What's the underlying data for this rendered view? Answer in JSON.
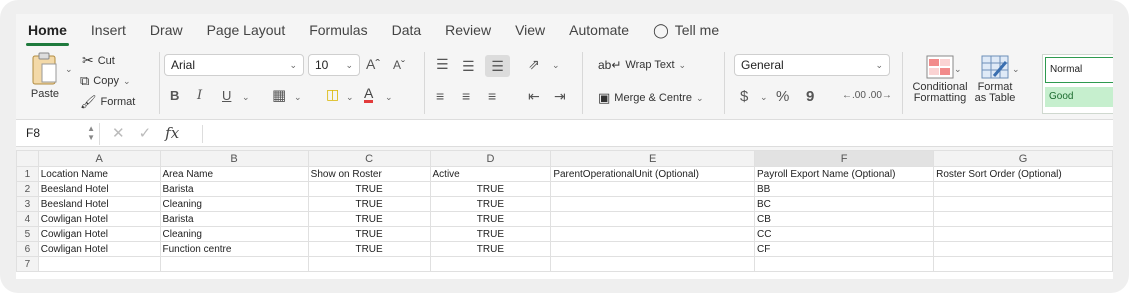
{
  "tabs": [
    "Home",
    "Insert",
    "Draw",
    "Page Layout",
    "Formulas",
    "Data",
    "Review",
    "View",
    "Automate"
  ],
  "tell_me": "Tell me",
  "clipboard": {
    "paste": "Paste",
    "cut": "Cut",
    "copy": "Copy",
    "format": "Format"
  },
  "font": {
    "name": "Arial",
    "size": "10",
    "bold": "B",
    "italic": "I",
    "underline": "U"
  },
  "alignment": {
    "wrap_text": "Wrap Text",
    "merge_center": "Merge & Centre"
  },
  "number": {
    "format": "General",
    "currency": "$",
    "percent": "%",
    "comma": "9"
  },
  "styles": {
    "conditional": "Conditional Formatting",
    "cond_line1": "Conditional",
    "cond_line2": "Formatting",
    "format_table_line1": "Format",
    "format_table_line2": "as Table",
    "normal": "Normal",
    "good": "Good"
  },
  "formula_bar": {
    "cell_ref": "F8",
    "formula": ""
  },
  "columns": [
    "A",
    "B",
    "C",
    "D",
    "E",
    "F",
    "G"
  ],
  "rows": [
    {
      "n": "1",
      "cells": [
        "Location Name",
        "Area Name",
        "Show on Roster",
        "Active",
        "ParentOperationalUnit (Optional)",
        "Payroll Export Name (Optional)",
        "Roster Sort Order (Optional)"
      ]
    },
    {
      "n": "2",
      "cells": [
        "Beesland Hotel",
        "Barista",
        "TRUE",
        "TRUE",
        "",
        "BB",
        ""
      ]
    },
    {
      "n": "3",
      "cells": [
        "Beesland Hotel",
        "Cleaning",
        "TRUE",
        "TRUE",
        "",
        "BC",
        ""
      ]
    },
    {
      "n": "4",
      "cells": [
        "Cowligan Hotel",
        "Barista",
        "TRUE",
        "TRUE",
        "",
        "CB",
        ""
      ]
    },
    {
      "n": "5",
      "cells": [
        "Cowligan Hotel",
        "Cleaning",
        "TRUE",
        "TRUE",
        "",
        "CC",
        ""
      ]
    },
    {
      "n": "6",
      "cells": [
        "Cowligan Hotel",
        "Function centre",
        "TRUE",
        "TRUE",
        "",
        "CF",
        ""
      ]
    },
    {
      "n": "7",
      "cells": [
        "",
        "",
        "",
        "",
        "",
        "",
        ""
      ]
    }
  ],
  "colors": {
    "accent": "#1f7a3d",
    "good_fill": "#c6efce"
  }
}
